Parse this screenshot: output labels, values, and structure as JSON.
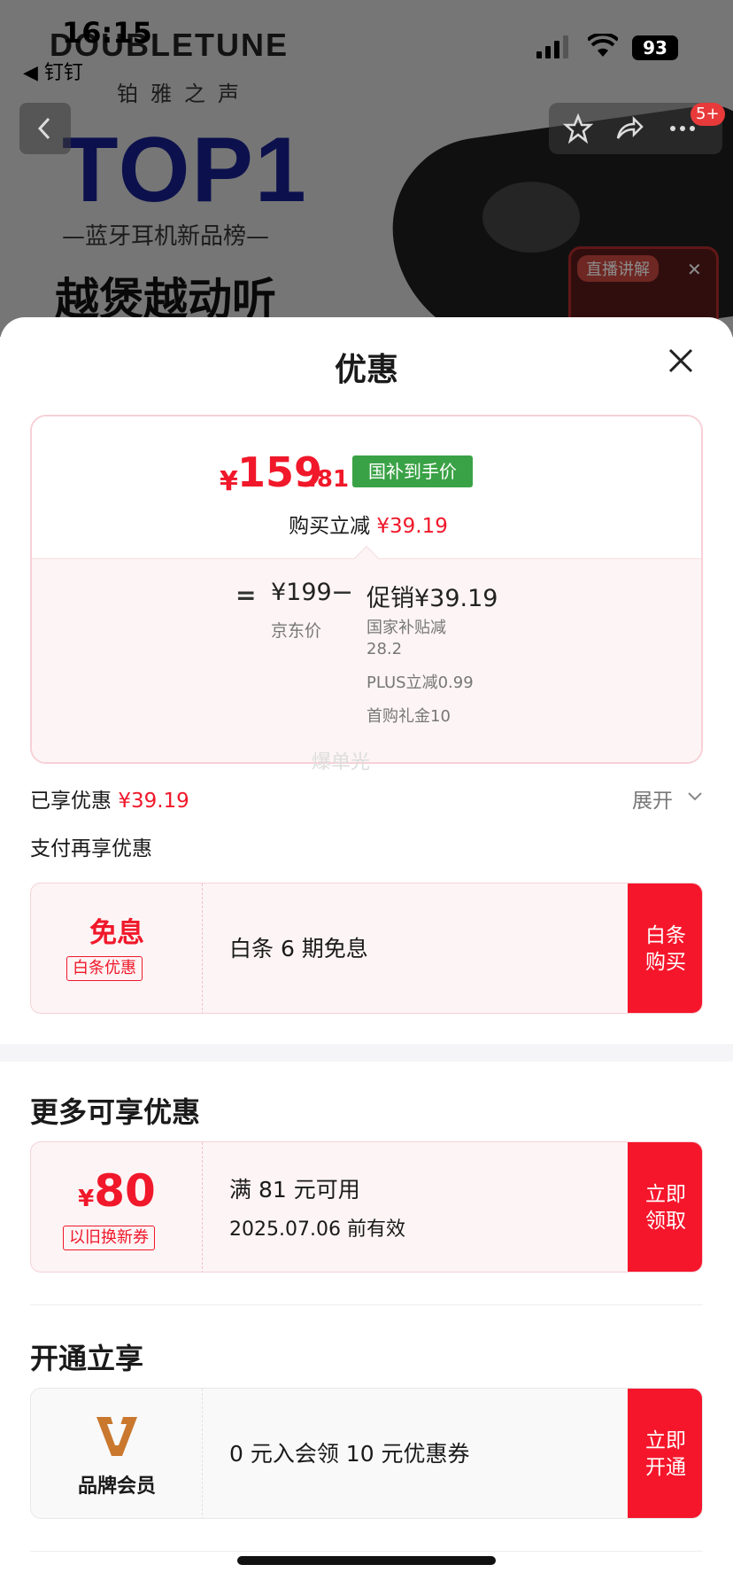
{
  "background": {
    "brand": "DOUBLETUNE",
    "brand_cn": "铂雅之声",
    "headline": "TOP1",
    "subline": "—蓝牙耳机新品榜—",
    "slogan": "越煲越动听",
    "live_tag": "直播讲解",
    "nav_badge": "5+"
  },
  "status_bar": {
    "time": "16:15",
    "back_app": "◀ 钉钉",
    "battery": "93"
  },
  "sheet": {
    "title": "优惠",
    "price": {
      "yen": "¥",
      "integer": "159",
      "decimal": ".81",
      "tag": "国补到手价",
      "buy_reduce_label": "购买立减",
      "buy_reduce_value": "¥39.19"
    },
    "breakdown": {
      "eq": "=",
      "jd_price": "¥199",
      "jd_label": "京东价",
      "minus": "−",
      "promo": "促销¥39.19",
      "items": [
        "国家补贴减",
        "28.2",
        "PLUS立减0.99",
        "首购礼金10"
      ]
    },
    "watermark": "爆单光",
    "enjoyed_label": "已享优惠",
    "enjoyed_value": "¥39.19",
    "expand_label": "展开",
    "pay_title": "支付再享优惠",
    "baitiao": {
      "main": "免息",
      "tag": "白条优惠",
      "desc": "白条 6 期免息",
      "button": "白条购买"
    },
    "more_title": "更多可享优惠",
    "tradein": {
      "yen": "¥",
      "amount": "80",
      "tag": "以旧换新券",
      "condition": "满 81 元可用",
      "expiry": "2025.07.06 前有效",
      "button": "立即领取"
    },
    "open_title": "开通立享",
    "member": {
      "label": "品牌会员",
      "desc": "0 元入会领 10 元优惠券",
      "button": "立即开通"
    },
    "colors": {
      "accent_red": "#f0182a",
      "button_red": "#f5162b",
      "subsidy_green": "#3aa246"
    }
  }
}
